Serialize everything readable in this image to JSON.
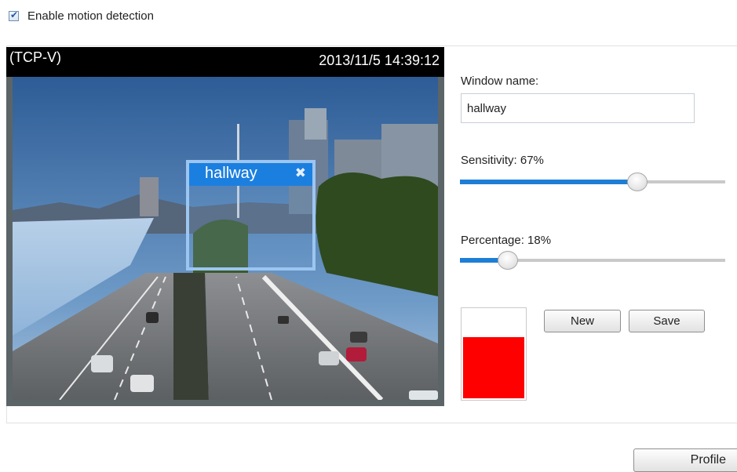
{
  "motion_detection": {
    "enable_label": "Enable motion detection",
    "enabled": true
  },
  "video": {
    "protocol": "(TCP-V)",
    "timestamp": "2013/11/5 14:39:12"
  },
  "motion_window": {
    "name": "hallway",
    "close_icon": "close-icon"
  },
  "controls": {
    "window_name_label": "Window name:",
    "window_name_value": "hallway",
    "sensitivity_label": "Sensitivity: 67%",
    "sensitivity_value": 67,
    "percentage_label": "Percentage: 18%",
    "percentage_value": 18,
    "activity_level": 0.7,
    "activity_color": "#ff0000",
    "new_label": "New",
    "save_label": "Save"
  },
  "footer": {
    "profile_label": "Profile"
  },
  "colors": {
    "accent": "#1e7ed6",
    "window_title": "#1b7fe0",
    "window_border": "#9cc6f1"
  }
}
